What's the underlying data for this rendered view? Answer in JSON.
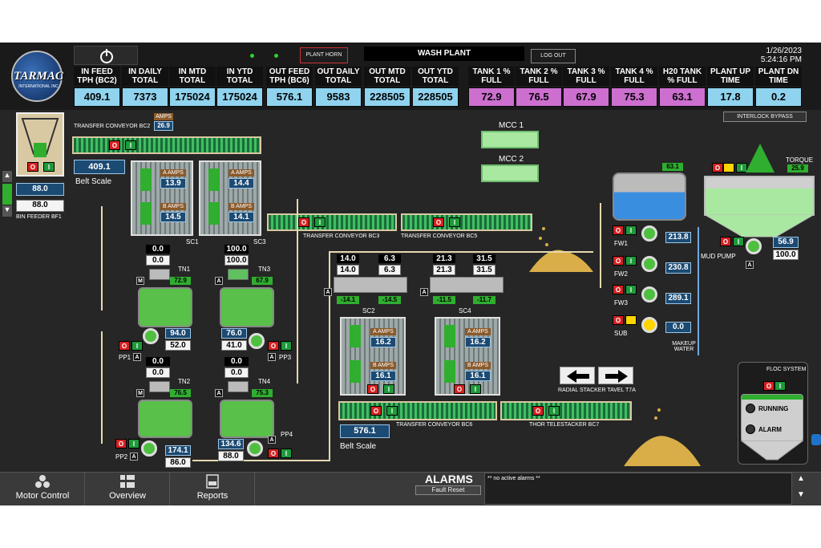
{
  "header": {
    "date": "1/26/2023",
    "time": "5:24:16 PM",
    "plant_horn": "PLANT HORN",
    "title": "WASH PLANT",
    "logout": "LOG OUT",
    "logo_text": "TARMAC",
    "logo_sub": "INTERNATIONAL INC"
  },
  "stats": [
    {
      "label": "IN FEED TPH (BC2)",
      "value": "409.1",
      "kind": "cyan"
    },
    {
      "label": "IN DAILY TOTAL",
      "value": "7373",
      "kind": "cyan"
    },
    {
      "label": "IN MTD TOTAL",
      "value": "175024",
      "kind": "cyan"
    },
    {
      "label": "IN YTD TOTAL",
      "value": "175024",
      "kind": "cyan"
    },
    {
      "label": "OUT FEED TPH (BC6)",
      "value": "576.1",
      "kind": "cyan"
    },
    {
      "label": "OUT DAILY TOTAL",
      "value": "9583",
      "kind": "cyan"
    },
    {
      "label": "OUT MTD TOTAL",
      "value": "228505",
      "kind": "cyan"
    },
    {
      "label": "OUT YTD TOTAL",
      "value": "228505",
      "kind": "cyan"
    },
    {
      "label": "TANK 1 % FULL",
      "value": "72.9",
      "kind": "mag"
    },
    {
      "label": "TANK 2 % FULL",
      "value": "76.5",
      "kind": "mag"
    },
    {
      "label": "TANK 3 % FULL",
      "value": "67.9",
      "kind": "mag"
    },
    {
      "label": "TANK 4 % FULL",
      "value": "75.3",
      "kind": "mag"
    },
    {
      "label": "H20 TANK % FULL",
      "value": "63.1",
      "kind": "mag"
    },
    {
      "label": "PLANT UP TIME",
      "value": "17.8",
      "kind": "cyan"
    },
    {
      "label": "PLANT DN TIME",
      "value": "0.2",
      "kind": "cyan"
    }
  ],
  "interlock": "INTERLOCK BYPASS",
  "btn": {
    "o": "O",
    "i": "I",
    "m": "M",
    "a": "A"
  },
  "labels": {
    "transfer_bc2": "TRANSFER CONVEYOR BC2",
    "belt_scale": "Belt Scale",
    "bin_feeder": "BIN FEEDER BF1",
    "transfer_bc3": "TRANSFER CONVEYOR BC3",
    "transfer_bc5": "TRANSFER CONVEYOR BC5",
    "transfer_bc6": "TRANSFER CONVEYOR BC6",
    "thor": "THOR TELESTACKER BC7",
    "radial": "RADIAL STACKER TAVEL T7A",
    "mcc1": "MCC 1",
    "mcc2": "MCC 2",
    "torque": "TORQUE",
    "mud_pump": "MUD PUMP",
    "makeup": "MAKEUP WATER",
    "floc": "FLOC SYSTEM",
    "running": "RUNNING",
    "alarm": "ALARM",
    "sc1": "SC1",
    "sc3": "SC3",
    "sc2": "SC2",
    "sc4": "SC4",
    "tn1": "TN1",
    "tn2": "TN2",
    "tn3": "TN3",
    "tn4": "TN4",
    "pp1": "PP1",
    "pp2": "PP2",
    "pp3": "PP3",
    "pp4": "PP4",
    "fw1": "FW1",
    "fw2": "FW2",
    "fw3": "FW3",
    "sub": "SUB",
    "amps": "AMPS",
    "a_amps": "A AMPS",
    "b_amps": "B AMPS"
  },
  "values": {
    "bc2_amps": "26.9",
    "bc2_scale": "409.1",
    "bf1_ind": "88.0",
    "bf1_val": "88.0",
    "sc1_a": "13.9",
    "sc1_b": "14.5",
    "sc3_a": "14.4",
    "sc3_b": "14.1",
    "tn1_top": "0.0",
    "tn1_val": "0.0",
    "tn1_pct": "72.9",
    "tn3_top": "100.0",
    "tn3_val": "100.0",
    "tn3_pct": "67.9",
    "pp1_ind": "94.0",
    "pp1_val": "52.0",
    "pp3_ind": "76.0",
    "pp3_val": "41.0",
    "tn2_top": "0.0",
    "tn2_val": "0.0",
    "tn2_pct": "76.5",
    "tn4_top": "0.0",
    "tn4_val": "0.0",
    "tn4_pct": "75.3",
    "pp2_ind": "174.1",
    "pp2_val": "86.0",
    "pp4_ind": "134.6",
    "pp4_val": "88.0",
    "sc2_c1_top": "14.0",
    "sc2_c1_val": "14.0",
    "sc2_c2_top": "6.3",
    "sc2_c2_val": "6.3",
    "sc4_c1_top": "21.3",
    "sc4_c1_val": "21.3",
    "sc4_c2_top": "31.5",
    "sc4_c2_val": "31.5",
    "sc2_n1": "-14.1",
    "sc2_n2": "-14.5",
    "sc4_n1": "-11.5",
    "sc4_n2": "-11.7",
    "sc2_a": "16.2",
    "sc2_b": "16.1",
    "sc4_a": "16.2",
    "sc4_b": "16.1",
    "bc6_scale": "576.1",
    "h2o_pct": "63.1",
    "torque": "25.9",
    "mud_ind": "56.9",
    "mud_val": "100.0",
    "fw1": "213.8",
    "fw2": "230.8",
    "fw3": "289.1",
    "sub": "0.0"
  },
  "nav": {
    "motor": "Motor Control",
    "overview": "Overview",
    "reports": "Reports",
    "alarms": "ALARMS",
    "fault_reset": "Fault Reset",
    "alarm_msg": "** no active alarms **"
  },
  "colors": {
    "cyan": "#8fd3ee",
    "magenta": "#cc6fcf",
    "green": "#2fae2f",
    "panel": "#262626"
  }
}
